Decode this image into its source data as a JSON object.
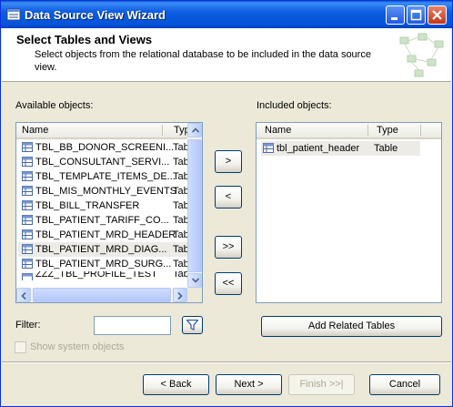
{
  "window": {
    "title": "Data Source View Wizard",
    "controls": [
      "minimize",
      "maximize",
      "close"
    ]
  },
  "header": {
    "title": "Select Tables and Views",
    "description": "Select objects from the relational database to be included in the data source view."
  },
  "available": {
    "label": "Available objects:",
    "columns": [
      "Name",
      "Typ"
    ],
    "rows": [
      {
        "name": "TBL_BB_DONOR_SCREENI...",
        "type": "Tab"
      },
      {
        "name": "TBL_CONSULTANT_SERVI...",
        "type": "Tab"
      },
      {
        "name": "TBL_TEMPLATE_ITEMS_DE...",
        "type": "Tab"
      },
      {
        "name": "TBL_MIS_MONTHLY_EVENTS",
        "type": "Tab"
      },
      {
        "name": "TBL_BILL_TRANSFER",
        "type": "Tab"
      },
      {
        "name": "TBL_PATIENT_TARIFF_CO...",
        "type": "Tab"
      },
      {
        "name": "TBL_PATIENT_MRD_HEADER",
        "type": "Tab"
      },
      {
        "name": "TBL_PATIENT_MRD_DIAG...",
        "type": "Tab"
      },
      {
        "name": "TBL_PATIENT_MRD_SURG...",
        "type": "Tab"
      },
      {
        "name": "ZZZ_TBL_PROFILE_TEST",
        "type": "Tab"
      }
    ]
  },
  "included": {
    "label": "Included objects:",
    "columns": [
      "Name",
      "Type"
    ],
    "rows": [
      {
        "name": "tbl_patient_header",
        "type": "Table"
      }
    ]
  },
  "transfer_buttons": {
    "add": ">",
    "remove": "<",
    "add_all": ">>",
    "remove_all": "<<"
  },
  "filter": {
    "label": "Filter:",
    "value": ""
  },
  "add_related_label": "Add Related Tables",
  "show_system_label": "Show system objects",
  "footer": {
    "back": "< Back",
    "next": "Next >",
    "finish": "Finish >>|",
    "cancel": "Cancel"
  },
  "colors": {
    "title_bar": "#0454d9",
    "dialog_bg": "#ece9d8",
    "selected_row": "#ecebe5"
  }
}
